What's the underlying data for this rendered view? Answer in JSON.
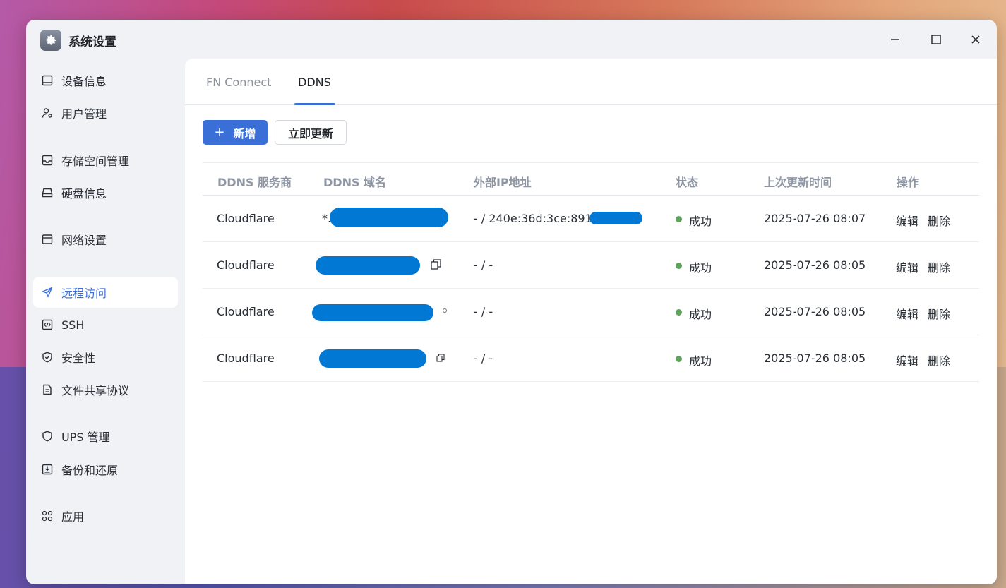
{
  "window": {
    "title": "系统设置",
    "icon": "gear-icon",
    "controls": [
      "minimize-icon",
      "maximize-icon",
      "close-icon"
    ]
  },
  "sidebar": {
    "items": [
      {
        "label": "设备信息",
        "icon": "monitor-icon",
        "active": false
      },
      {
        "label": "用户管理",
        "icon": "user-gear-icon",
        "active": false
      },
      {
        "label": "存储空间管理",
        "icon": "storage-icon",
        "active": false
      },
      {
        "label": "硬盘信息",
        "icon": "disk-icon",
        "active": false
      },
      {
        "label": "网络设置",
        "icon": "network-icon",
        "active": false
      },
      {
        "label": "远程访问",
        "icon": "send-icon",
        "active": true
      },
      {
        "label": "SSH",
        "icon": "code-icon",
        "active": false
      },
      {
        "label": "安全性",
        "icon": "shield-check-icon",
        "active": false
      },
      {
        "label": "文件共享协议",
        "icon": "file-icon",
        "active": false
      },
      {
        "label": "UPS 管理",
        "icon": "shield-icon",
        "active": false
      },
      {
        "label": "备份和还原",
        "icon": "backup-icon",
        "active": false
      },
      {
        "label": "应用",
        "icon": "apps-icon",
        "active": false
      }
    ]
  },
  "tabs": [
    {
      "label": "FN Connect",
      "active": false
    },
    {
      "label": "DDNS",
      "active": true
    }
  ],
  "toolbar": {
    "add_label": "新增",
    "update_label": "立即更新"
  },
  "table": {
    "columns": [
      "DDNS 服务商",
      "DDNS 域名",
      "外部IP地址",
      "状态",
      "上次更新时间",
      "操作"
    ],
    "rows": [
      {
        "provider": "Cloudflare",
        "domain": "*.",
        "ip": "- / 240e:36d:3ce:8910:",
        "status": "成功",
        "updated": "2025-07-26 08:07",
        "edit": "编辑",
        "delete": "删除"
      },
      {
        "provider": "Cloudflare",
        "domain": "",
        "ip": "- / -",
        "status": "成功",
        "updated": "2025-07-26 08:05",
        "edit": "编辑",
        "delete": "删除"
      },
      {
        "provider": "Cloudflare",
        "domain": "",
        "ip": "- / -",
        "status": "成功",
        "updated": "2025-07-26 08:05",
        "edit": "编辑",
        "delete": "删除"
      },
      {
        "provider": "Cloudflare",
        "domain": "",
        "ip": "- / -",
        "status": "成功",
        "updated": "2025-07-26 08:05",
        "edit": "编辑",
        "delete": "删除"
      }
    ]
  },
  "colors": {
    "accent": "#3a6fd8",
    "success": "#5ea35a",
    "redaction": "#0078d4"
  }
}
